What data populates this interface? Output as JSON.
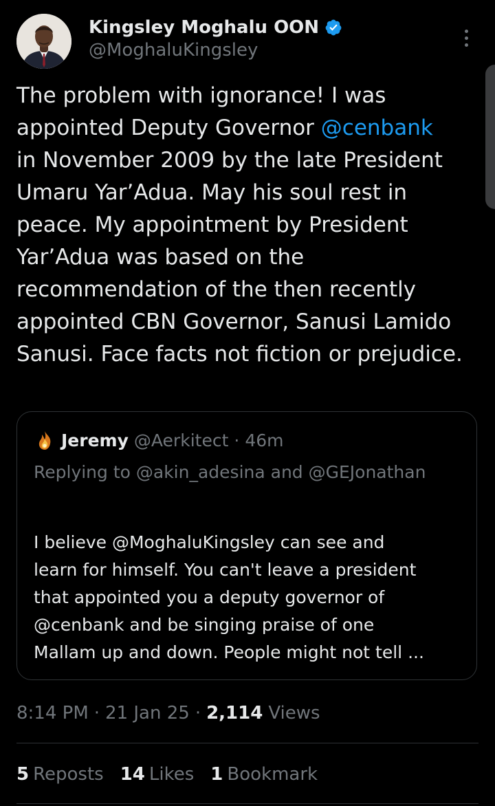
{
  "colors": {
    "background": "#000000",
    "text_primary": "#e7e9ea",
    "text_secondary": "#71767b",
    "link": "#1d9bf0",
    "verified_badge": "#1d9bf0",
    "border": "#2f3336"
  },
  "author": {
    "name": "Kingsley Moghalu OON",
    "handle": "@MoghaluKingsley",
    "verified": true,
    "avatar_icon": "profile-photo"
  },
  "more_icon": "more-vertical-icon",
  "tweet": {
    "text_before_mention": "The problem with ignorance! I was appointed Deputy Governor ",
    "mention": "@cenbank",
    "text_after_mention": "\nin November 2009 by the late President Umaru Yar’Adua. May his soul rest in peace. My appointment by President Yar’Adua was based on the recommendation of the then recently appointed CBN Governor, Sanusi Lamido Sanusi.  Face facts not fiction or prejudice."
  },
  "quote": {
    "name": "Jeremy",
    "handle": "@Aerkitect",
    "separator": "·",
    "time": "46m",
    "replying_to": "Replying to @akin_adesina and @GEJonathan",
    "text": "I believe @MoghaluKingsley can see and\nlearn for himself. You can't leave a president\nthat appointed you a deputy governor of\n@cenbank and be singing praise of one\nMallam up and down. People might not tell ..."
  },
  "meta": {
    "time": "8:14 PM",
    "sep1": "·",
    "date": "21 Jan 25",
    "sep2": "·",
    "views_count": "2,114",
    "views_label": "Views"
  },
  "stats": [
    {
      "count": "5",
      "label": "Reposts"
    },
    {
      "count": "14",
      "label": "Likes"
    },
    {
      "count": "1",
      "label": "Bookmark"
    }
  ]
}
